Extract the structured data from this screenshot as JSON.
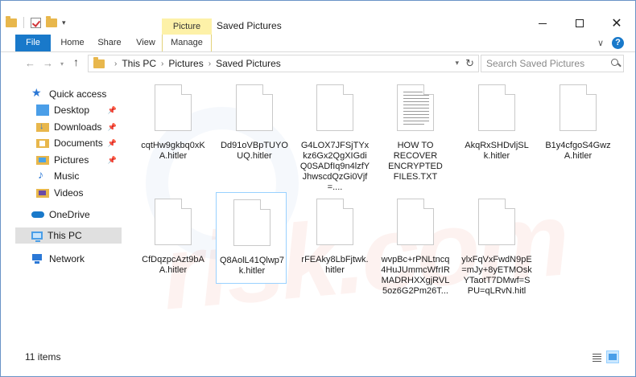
{
  "window": {
    "title": "Saved Pictures",
    "context_tab_group": "Picture Tools"
  },
  "ribbon": {
    "tabs": [
      "File",
      "Home",
      "Share",
      "View",
      "Manage"
    ]
  },
  "address": {
    "crumbs": [
      "This PC",
      "Pictures",
      "Saved Pictures"
    ]
  },
  "search": {
    "placeholder": "Search Saved Pictures"
  },
  "navpane": {
    "quick_access": "Quick access",
    "items": [
      "Desktop",
      "Downloads",
      "Documents",
      "Pictures",
      "Music",
      "Videos"
    ],
    "onedrive": "OneDrive",
    "this_pc": "This PC",
    "network": "Network"
  },
  "files": [
    {
      "name": "cqtHw9gkbq0xKA.hitler",
      "type": "blank"
    },
    {
      "name": "Dd91oVBpTUYOUQ.hitler",
      "type": "blank"
    },
    {
      "name": "G4LOX7JFSjTYxkz6Gx2QgXIGdiQ0SADfIq9n4lzfYJhwscdQzGi0Vjf=....",
      "type": "blank"
    },
    {
      "name": "HOW TO RECOVER ENCRYPTED FILES.TXT",
      "type": "text"
    },
    {
      "name": "AkqRxSHDvljSLk.hitler",
      "type": "blank"
    },
    {
      "name": "B1y4cfgoS4GwzA.hitler",
      "type": "blank"
    },
    {
      "name": "CfDqzpcAzt9bAA.hitler",
      "type": "blank"
    },
    {
      "name": "Q8AolL41Qlwp7k.hitler",
      "type": "blank",
      "selected": true
    },
    {
      "name": "rFEAky8LbFjtwk.hitler",
      "type": "blank"
    },
    {
      "name": "wvpBc+rPNLtncq4HuJUmmcWfrIRMADRHXXgjRVL5oz6G2Pm26T...",
      "type": "blank"
    },
    {
      "name": "ylxFqVxFwdN9pE=mJy+8yETMOskYTaotT7DMwf=SPU=qLRvN.hitl",
      "type": "blank"
    }
  ],
  "status": {
    "count": "11 items"
  },
  "watermark": "risk.com"
}
